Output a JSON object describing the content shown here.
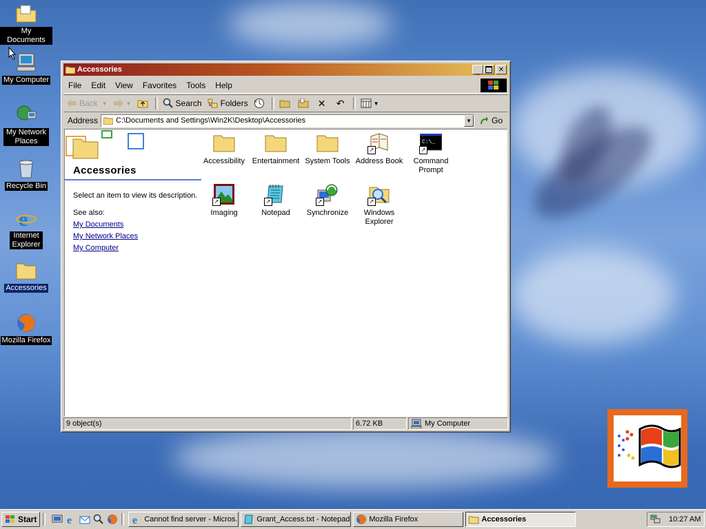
{
  "desktop": {
    "icons": [
      {
        "label": "My Documents"
      },
      {
        "label": "My Computer"
      },
      {
        "label": "My Network Places"
      },
      {
        "label": "Recycle Bin"
      },
      {
        "label": "Internet Explorer"
      },
      {
        "label": "Accessories"
      },
      {
        "label": "Mozilla Firefox"
      }
    ]
  },
  "window": {
    "title": "Accessories",
    "menu": [
      "File",
      "Edit",
      "View",
      "Favorites",
      "Tools",
      "Help"
    ],
    "toolbar": {
      "back": "Back",
      "search": "Search",
      "folders": "Folders"
    },
    "address": {
      "label": "Address",
      "value": "C:\\Documents and Settings\\Win2K\\Desktop\\Accessories",
      "go": "Go"
    },
    "left_pane": {
      "folder_name": "Accessories",
      "description": "Select an item to view its description.",
      "see_also": "See also:",
      "links": [
        "My Documents",
        "My Network Places",
        "My Computer"
      ]
    },
    "items": [
      {
        "label": "Accessibility",
        "icon": "folder-icon"
      },
      {
        "label": "Entertainment",
        "icon": "folder-icon"
      },
      {
        "label": "System Tools",
        "icon": "folder-icon"
      },
      {
        "label": "Address Book",
        "icon": "address-book-icon"
      },
      {
        "label": "Command Prompt",
        "icon": "command-prompt-icon"
      },
      {
        "label": "Imaging",
        "icon": "imaging-icon"
      },
      {
        "label": "Notepad",
        "icon": "notepad-icon"
      },
      {
        "label": "Synchronize",
        "icon": "synchronize-icon"
      },
      {
        "label": "Windows Explorer",
        "icon": "windows-explorer-icon"
      }
    ],
    "status": {
      "objects": "9 object(s)",
      "size": "6.72 KB",
      "zone": "My Computer"
    }
  },
  "taskbar": {
    "start": "Start",
    "tasks": [
      {
        "label": "Cannot find server - Micros...",
        "active": false
      },
      {
        "label": "Grant_Access.txt - Notepad",
        "active": false
      },
      {
        "label": "Mozilla Firefox",
        "active": false
      },
      {
        "label": "Accessories",
        "active": true
      }
    ],
    "clock": "10:27 AM"
  },
  "colors": {
    "title_gradient_start": "#8b1e1e",
    "title_gradient_end": "#e8c45c",
    "desktop_blue": "#3f6fb5",
    "selection": "#0a246a"
  }
}
